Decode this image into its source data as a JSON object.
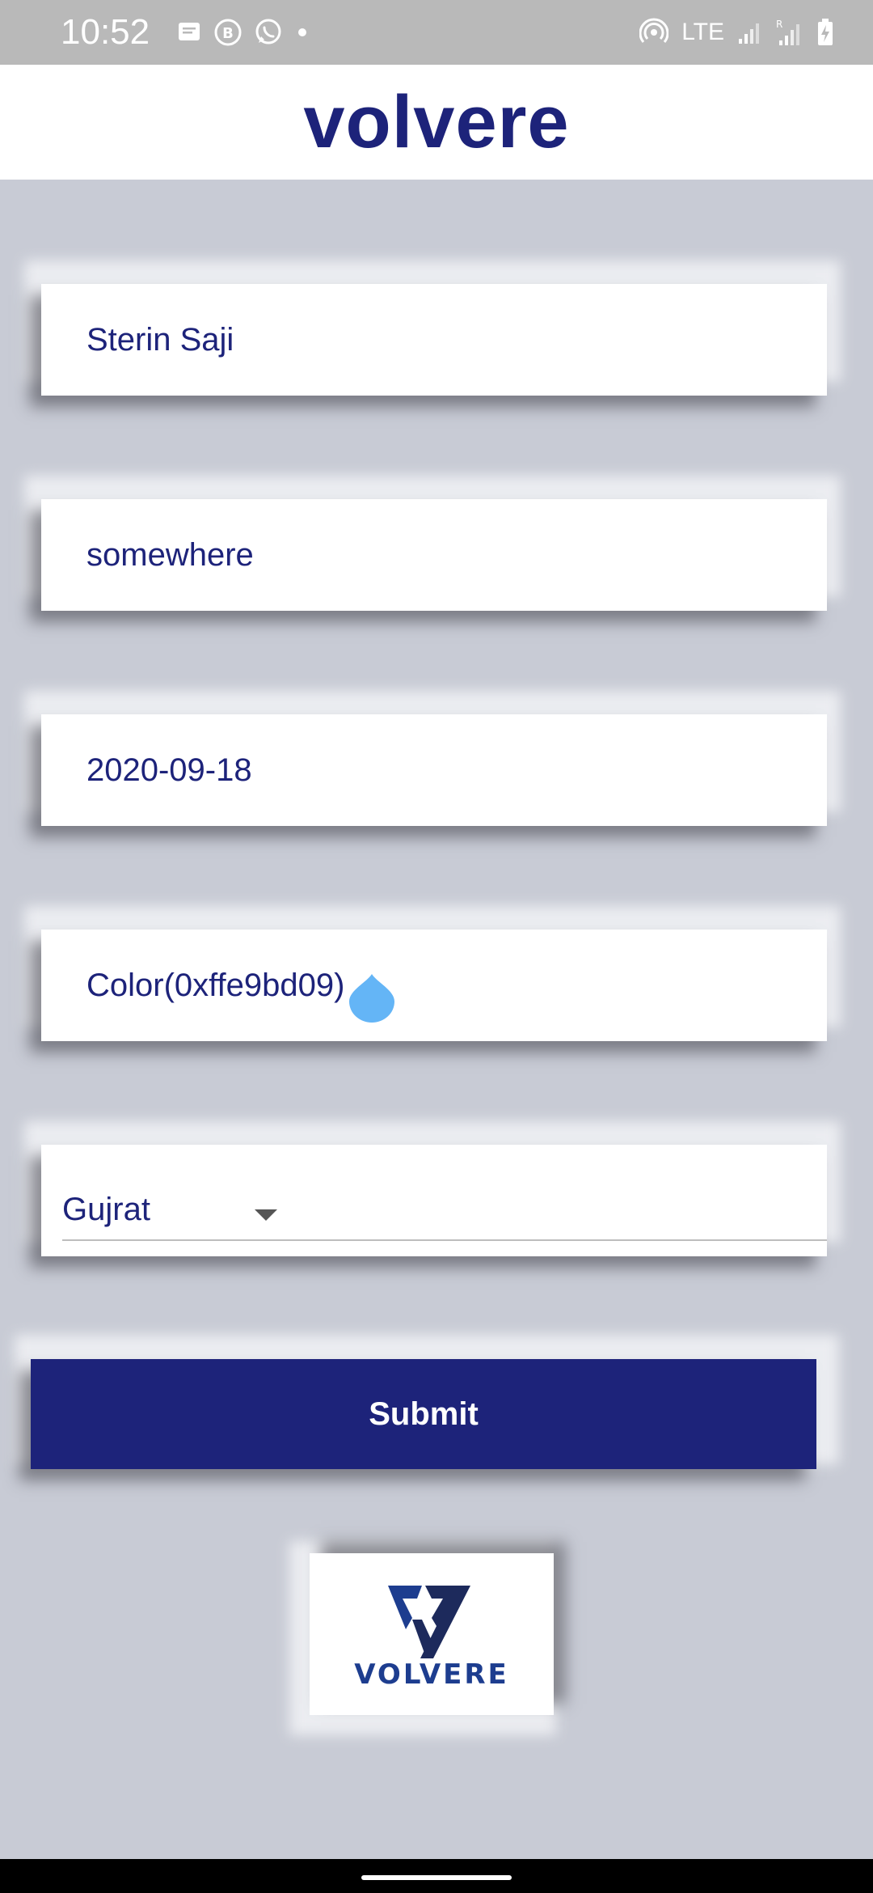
{
  "status_bar": {
    "time": "10:52",
    "network": "LTE",
    "left_icons": [
      "message-icon",
      "b-app-icon",
      "whatsapp-icon",
      "dot-icon"
    ],
    "right_icons": [
      "hotspot-icon",
      "signal-icon",
      "signal-roaming-icon",
      "battery-charging-icon"
    ]
  },
  "header": {
    "title": "volvere"
  },
  "form": {
    "name_value": "Sterin Saji",
    "address_value": "somewhere",
    "date_value": "2020-09-18",
    "color_value": "Color(0xffe9bd09)",
    "state_value": "Gujrat",
    "submit_label": "Submit"
  },
  "logo": {
    "text": "VOLVERE"
  },
  "colors": {
    "brand": "#1d237a",
    "background": "#c8cbd5",
    "cursor_handle": "#64b5f6",
    "statusbar": "#b9b9b9"
  }
}
